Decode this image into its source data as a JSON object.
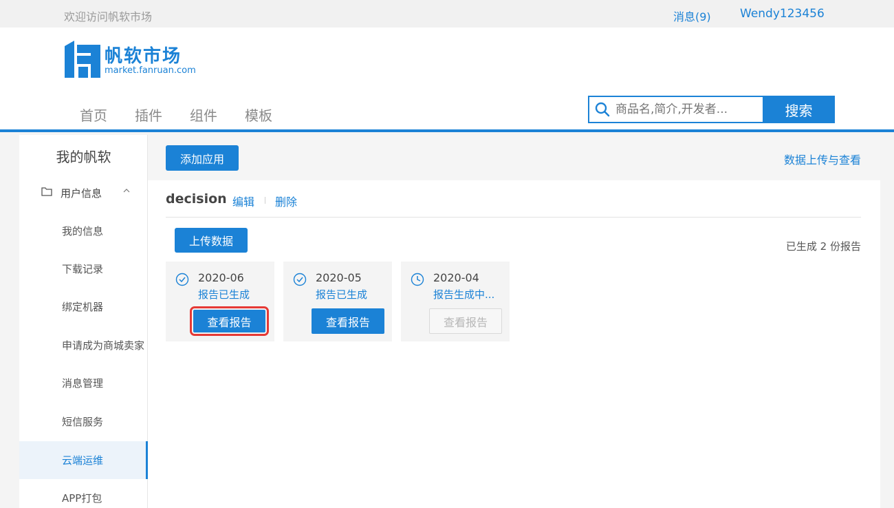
{
  "topbar": {
    "welcome": "欢迎访问帆软市场",
    "messages": "消息(9)",
    "username": "Wendy123456"
  },
  "header": {
    "logo_cn": "帆软市场",
    "logo_en": "market.fanruan.com",
    "nav": [
      "首页",
      "插件",
      "组件",
      "模板"
    ],
    "search_placeholder": "商品名,简介,开发者...",
    "search_button": "搜索"
  },
  "sidebar": {
    "title": "我的帆软",
    "group_label": "用户信息",
    "items": [
      "我的信息",
      "下载记录",
      "绑定机器",
      "申请成为商城卖家",
      "消息管理",
      "短信服务",
      "云端运维",
      "APP打包"
    ],
    "active_item": "云端运维"
  },
  "main": {
    "add_app_button": "添加应用",
    "upload_view_link": "数据上传与查看",
    "app_name": "decision",
    "edit_link": "编辑",
    "delete_link": "删除",
    "upload_button": "上传数据",
    "report_count": "已生成 2 份报告",
    "reports": [
      {
        "date": "2020-06",
        "status": "报告已生成",
        "button": "查看报告",
        "state": "done"
      },
      {
        "date": "2020-05",
        "status": "报告已生成",
        "button": "查看报告",
        "state": "done"
      },
      {
        "date": "2020-04",
        "status": "报告生成中...",
        "button": "查看报告",
        "state": "pending"
      }
    ]
  },
  "colors": {
    "accent": "#1b82d6",
    "highlight": "#e53935"
  }
}
